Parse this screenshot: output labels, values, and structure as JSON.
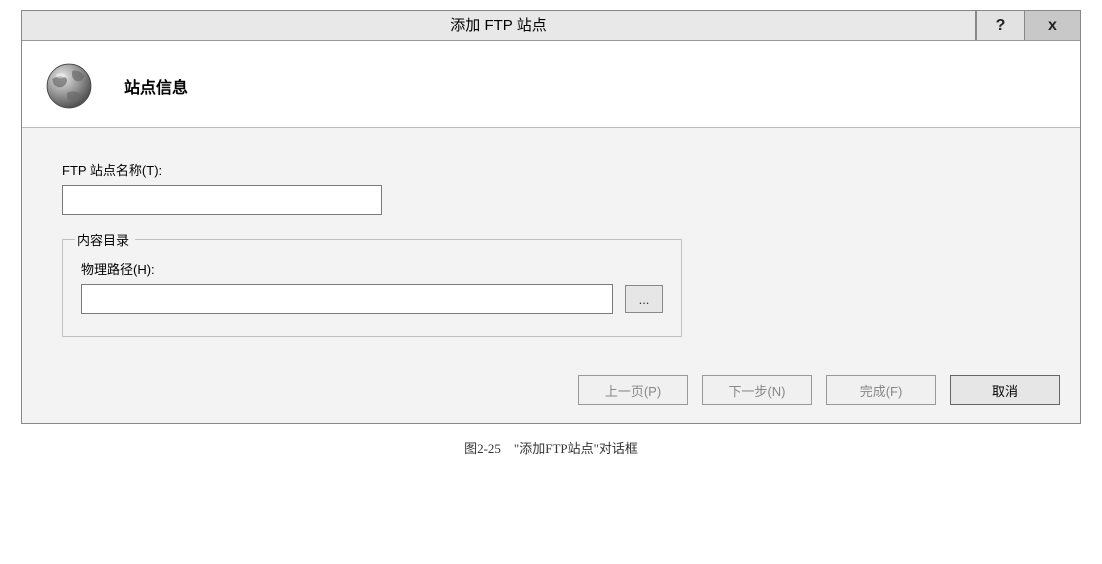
{
  "dialog": {
    "title": "添加 FTP 站点",
    "help_label": "?",
    "close_label": "x"
  },
  "header": {
    "title": "站点信息",
    "icon": "globe-icon"
  },
  "fields": {
    "ftp_name_label": "FTP 站点名称(T):",
    "ftp_name_value": "",
    "content_dir_legend": "内容目录",
    "physical_path_label": "物理路径(H):",
    "physical_path_value": "",
    "browse_label": "..."
  },
  "buttons": {
    "prev": "上一页(P)",
    "next": "下一步(N)",
    "finish": "完成(F)",
    "cancel": "取消"
  },
  "caption": "图2-25　\"添加FTP站点\"对话框"
}
